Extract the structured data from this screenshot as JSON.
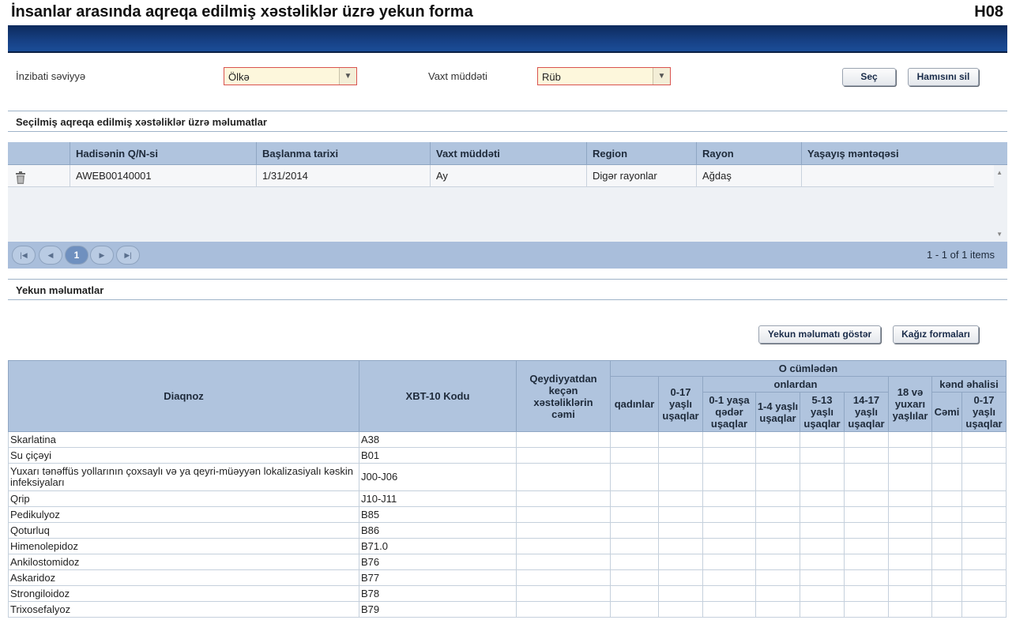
{
  "header": {
    "title": "İnsanlar arasında aqreqa edilmiş xəstəliklər üzrə yekun forma",
    "code": "H08"
  },
  "filters": {
    "admin_level_label": "İnzibati səviyyə",
    "admin_level_value": "Ölkə",
    "period_label": "Vaxt müddəti",
    "period_value": "Rüb",
    "select_button": "Seç",
    "clear_all_button": "Hamısını sil"
  },
  "selected_section": {
    "title": "Seçilmiş aqreqa edilmiş xəstəliklər üzrə məlumatlar",
    "columns": [
      "Hadisənin Q/N-si",
      "Başlanma tarixi",
      "Vaxt müddəti",
      "Region",
      "Rayon",
      "Yaşayış məntəqəsi"
    ],
    "rows": [
      [
        "AWEB00140001",
        "1/31/2014",
        "Ay",
        "Digər rayonlar",
        "Ağdaş",
        ""
      ]
    ],
    "pager": {
      "current_page": "1",
      "info": "1 - 1 of 1 items"
    }
  },
  "summary_section": {
    "title": "Yekun məlumatlar",
    "show_button": "Yekun məlumatı göstər",
    "paper_forms_button": "Kağız formaları",
    "headers": {
      "diagnosis": "Diaqnoz",
      "code": "XBT-10 Kodu",
      "total": "Qeydiyyatdan keçən xəstəliklərin cəmi",
      "including": "O cümlədən",
      "women": "qadınlar",
      "children_0_17": "0-17 yaşlı uşaqlar",
      "of_which": "onlardan",
      "age_0_1": "0-1 yaşa qədər uşaqlar",
      "age_1_4": "1-4 yaşlı uşaqlar",
      "age_5_13": "5-13 yaşlı uşaqlar",
      "age_14_17": "14-17 yaşlı uşaqlar",
      "age_18_plus": "18 və yuxarı yaşlılar",
      "rural": "kənd əhalisi",
      "rural_total": "Cəmi",
      "rural_0_17": "0-17 yaşlı uşaqlar"
    },
    "rows": [
      {
        "diagnosis": "Skarlatina",
        "code": "A38"
      },
      {
        "diagnosis": "Su çiçəyi",
        "code": "B01"
      },
      {
        "diagnosis": "Yuxarı tənəffüs yollarının çoxsaylı və ya qeyri-müəyyən lokalizasiyalı kəskin infeksiyaları",
        "code": "J00-J06"
      },
      {
        "diagnosis": "Qrip",
        "code": "J10-J11"
      },
      {
        "diagnosis": "Pedikulyoz",
        "code": "B85"
      },
      {
        "diagnosis": "Qoturluq",
        "code": "B86"
      },
      {
        "diagnosis": "Himenolepidoz",
        "code": "B71.0"
      },
      {
        "diagnosis": "Ankilostomidoz",
        "code": "B76"
      },
      {
        "diagnosis": "Askaridoz",
        "code": "B77"
      },
      {
        "diagnosis": "Strongiloidoz",
        "code": "B78"
      },
      {
        "diagnosis": "Trixosefalyoz",
        "code": "B79"
      }
    ]
  },
  "icons": {
    "delete": "trash-icon",
    "first": "first-page-icon",
    "prev": "prev-page-icon",
    "next": "next-page-icon",
    "last": "last-page-icon",
    "dropdown": "chevron-down-icon"
  },
  "colors": {
    "header_band": "#163f82",
    "grid_header": "#b0c4de",
    "select_bg": "#fdf7dc",
    "select_border": "#d9534f"
  }
}
